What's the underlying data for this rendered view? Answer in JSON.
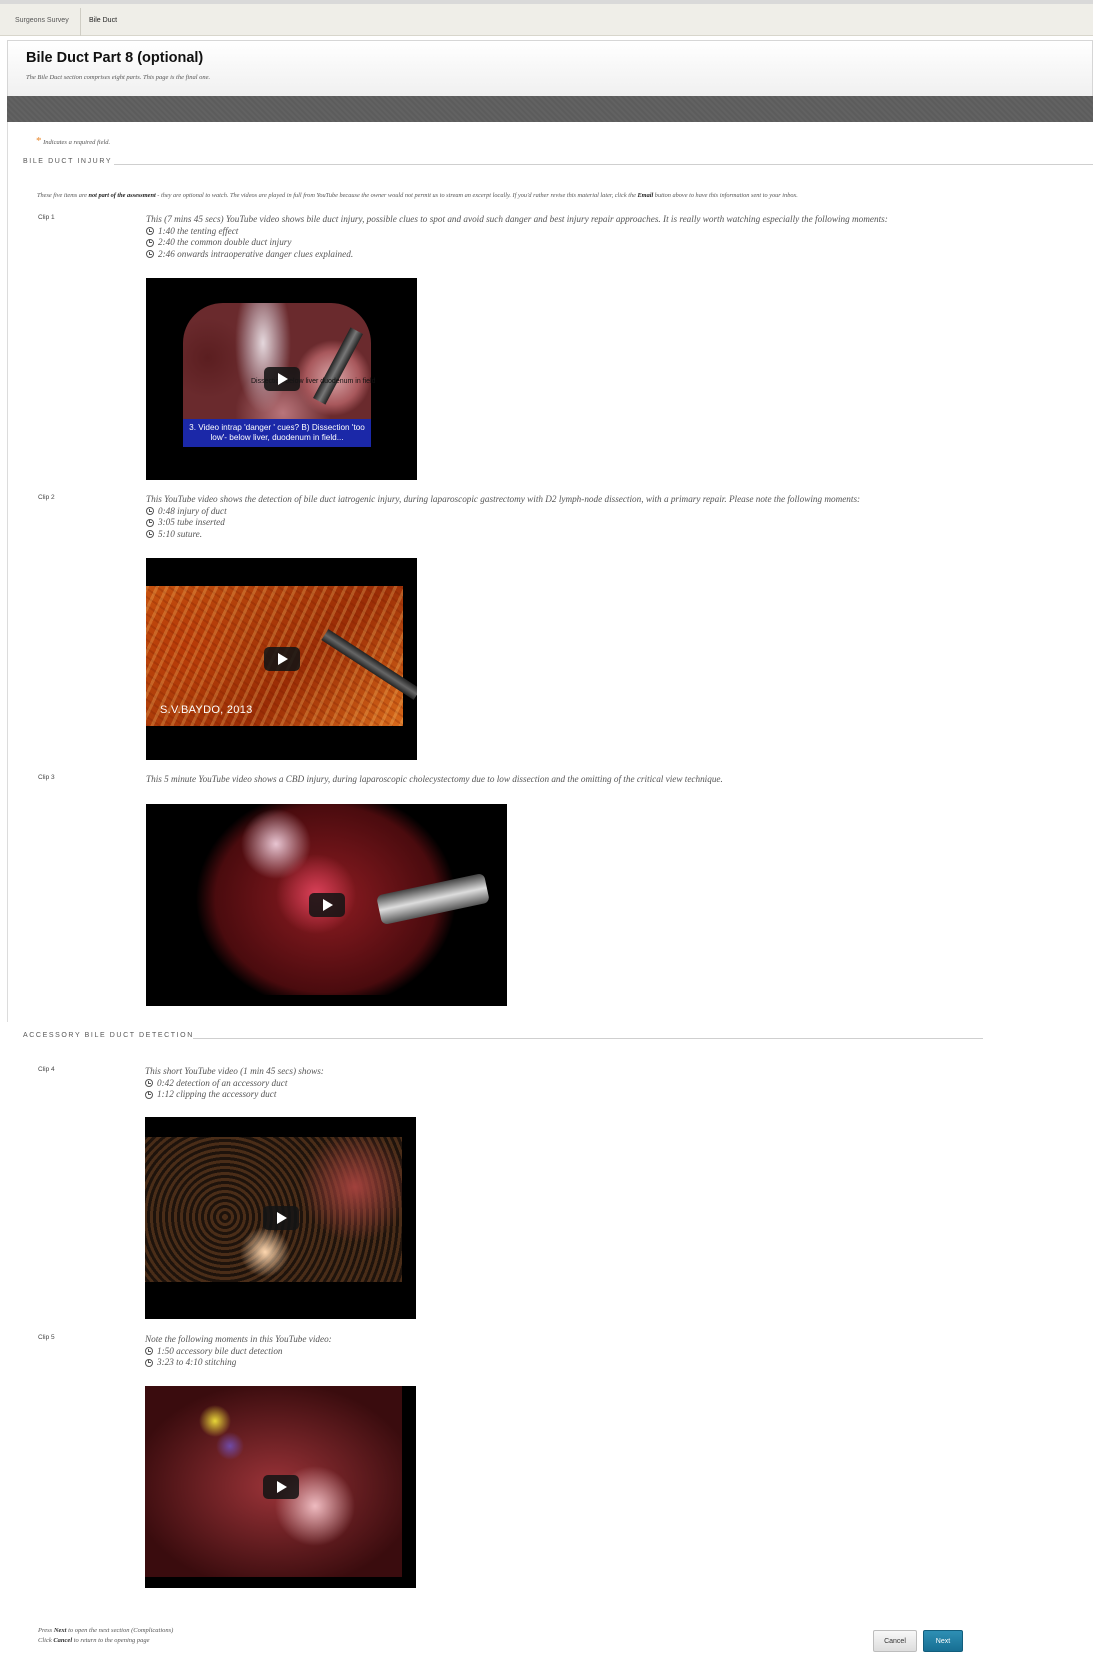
{
  "breadcrumb": {
    "items": [
      "Surgeons Survey",
      "Bile Duct"
    ]
  },
  "header": {
    "title": "Bile Duct Part 8 (optional)",
    "subtitle": "The Bile Duct section comprises eight parts. This page is the final one."
  },
  "required_note": {
    "star": "*",
    "text": "Indicates a required field."
  },
  "sections": {
    "bile_duct_injury": "BILE DUCT INJURY",
    "accessory": "ACCESSORY BILE DUCT DETECTION"
  },
  "intro": {
    "part1": "These five items are ",
    "bold1": "not part of the assessment",
    "part2": " - they are optional to watch. The videos are played in full from YouTube because the owner would not permit us to stream an excerpt locally. If you'd rather revise this material later, click the ",
    "bold2": "Email",
    "part3": " button above to have this information sent to your inbox."
  },
  "clips": [
    {
      "label": "Clip 1",
      "text": "This (7 mins 45 secs) YouTube video shows bile duct injury, possible clues to spot and avoid such danger and best injury repair approaches. It is really worth watching especially the following moments:",
      "moments": [
        "1:40 the tenting effect",
        "2:40 the common double duct injury",
        "2:46 onwards intraoperative danger clues explained."
      ],
      "video_caption": "3. Video intrap 'danger ' cues? B) Dissection 'too low'- below liver, duodenum in field...",
      "video_overlay": "Dissection below liver duodenum in field"
    },
    {
      "label": "Clip 2",
      "text": "This YouTube video shows the detection of bile duct iatrogenic injury, during laparoscopic gastrectomy with D2 lymph-node dissection, with a primary repair. Please note the following moments:",
      "moments": [
        "0:48 injury of duct",
        "3:05 tube inserted",
        "5:10 suture."
      ],
      "video_watermark": "S.V.BAYDO, 2013"
    },
    {
      "label": "Clip 3",
      "text": "This 5 minute YouTube video shows a CBD injury, during laparoscopic cholecystectomy due to low dissection and the omitting of the critical view technique.",
      "moments": []
    },
    {
      "label": "Clip 4",
      "text": "This short YouTube video (1 min 45 secs) shows:",
      "moments": [
        "0:42 detection of an accessory duct",
        "1:12 clipping the accessory duct"
      ]
    },
    {
      "label": "Clip 5",
      "text": "Note the following moments in this YouTube video:",
      "moments": [
        "1:50 accessory bile duct detection",
        "3:23 to 4:10 stitching"
      ]
    }
  ],
  "footer": {
    "line1_pre": "Press ",
    "line1_bold": "Next",
    "line1_post": " to open the next section (Complications)",
    "line2_pre": "Click ",
    "line2_bold": "Cancel",
    "line2_post": " to return to the opening page"
  },
  "buttons": {
    "cancel": "Cancel",
    "next": "Next"
  },
  "icons": {
    "moment": "clock-icon",
    "play": "play-button-icon",
    "required": "asterisk-icon"
  },
  "colors": {
    "accent": "#1a7aa3",
    "required_star": "#e8862a",
    "header_band": "#5e5e5e"
  }
}
